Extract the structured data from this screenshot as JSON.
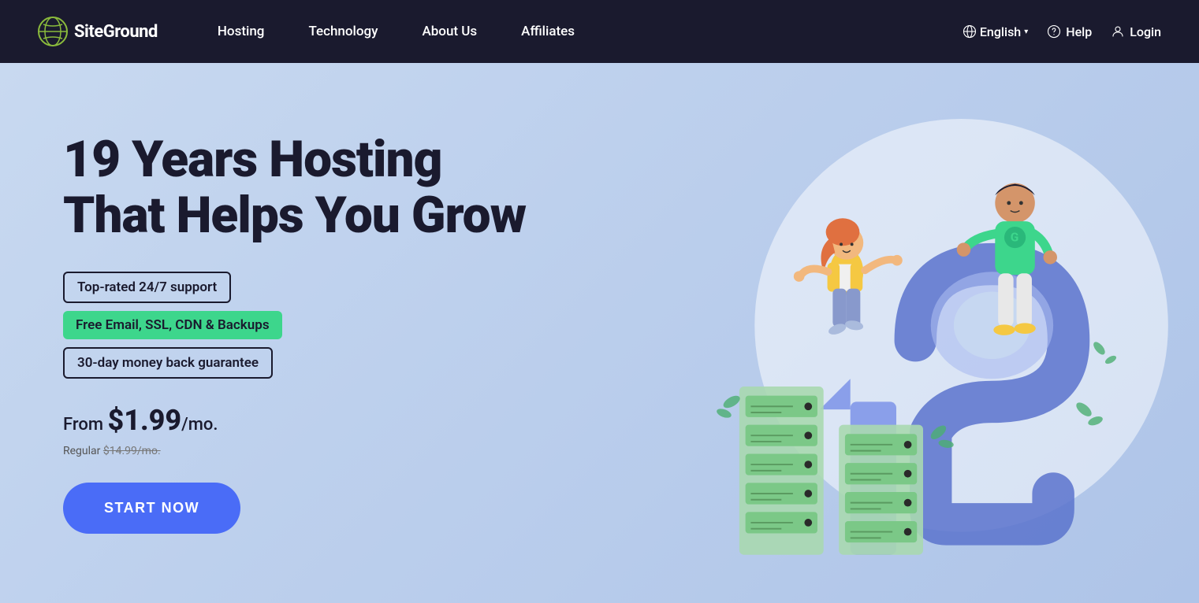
{
  "nav": {
    "logo_text": "SiteGround",
    "links": [
      {
        "label": "Hosting",
        "id": "hosting"
      },
      {
        "label": "Technology",
        "id": "technology"
      },
      {
        "label": "About Us",
        "id": "about-us"
      },
      {
        "label": "Affiliates",
        "id": "affiliates"
      }
    ],
    "language": "English",
    "help": "Help",
    "login": "Login"
  },
  "hero": {
    "title_line1": "19 Years Hosting",
    "title_line2": "That Helps You Grow",
    "badges": [
      {
        "text": "Top-rated 24/7 support",
        "style": "outline"
      },
      {
        "text": "Free Email, SSL, CDN & Backups",
        "style": "green"
      },
      {
        "text": "30-day money back guarantee",
        "style": "outline"
      }
    ],
    "pricing": {
      "from_label": "From ",
      "amount": "$1.99",
      "period": "/mo.",
      "regular_label": "Regular ",
      "regular_price": "$14.99/mo."
    },
    "cta_button": "START NOW"
  },
  "colors": {
    "background": "#c8d9f0",
    "nav_bg": "#1a1a2e",
    "accent_blue": "#4a6cf7",
    "accent_green": "#3dd68c",
    "text_dark": "#1a1a2e"
  }
}
